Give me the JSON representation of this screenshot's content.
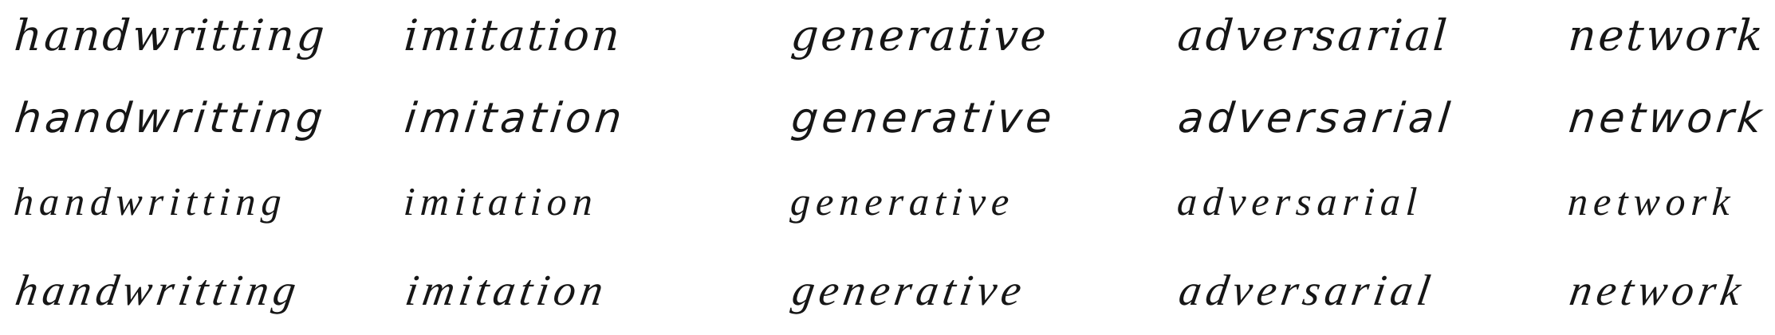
{
  "rows": [
    {
      "words": [
        "handwritting",
        "imitation",
        "generative",
        "adversarial",
        "network"
      ]
    },
    {
      "words": [
        "handwritting",
        "imitation",
        "generative",
        "adversarial",
        "network"
      ]
    },
    {
      "words": [
        "handwritting",
        "imitation",
        "generative",
        "adversarial",
        "network"
      ]
    },
    {
      "words": [
        "handwritting",
        "imitation",
        "generative",
        "adversarial",
        "network"
      ]
    }
  ],
  "colors": {
    "background": "#ffffff",
    "ink": "#161616"
  }
}
